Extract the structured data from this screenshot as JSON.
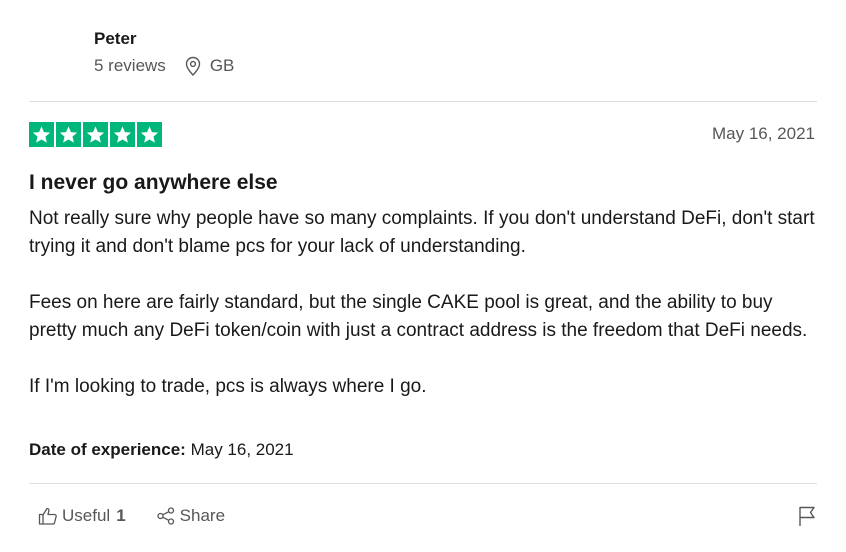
{
  "reviewer": {
    "name": "Peter",
    "reviews_count": "5 reviews",
    "country": "GB",
    "location_icon": "location-pin-icon"
  },
  "review": {
    "rating": 5,
    "rating_color": "#00b67a",
    "date": "May 16, 2021",
    "title": "I never go anywhere else",
    "paragraphs": [
      "Not really sure why people have so many complaints. If you don't understand DeFi, don't start trying it and don't blame pcs for your lack of understanding.",
      "Fees on here are fairly standard, but the single CAKE pool is great, and the ability to buy pretty much any DeFi token/coin with just a contract address is the freedom that DeFi needs.",
      "If I'm looking to trade, pcs is always where I go."
    ],
    "experience_label": "Date of experience:",
    "experience_date": "May 16, 2021"
  },
  "actions": {
    "useful_label": "Useful",
    "useful_count": "1",
    "share_label": "Share",
    "useful_icon": "thumbs-up-icon",
    "share_icon": "share-icon",
    "report_icon": "flag-icon"
  }
}
